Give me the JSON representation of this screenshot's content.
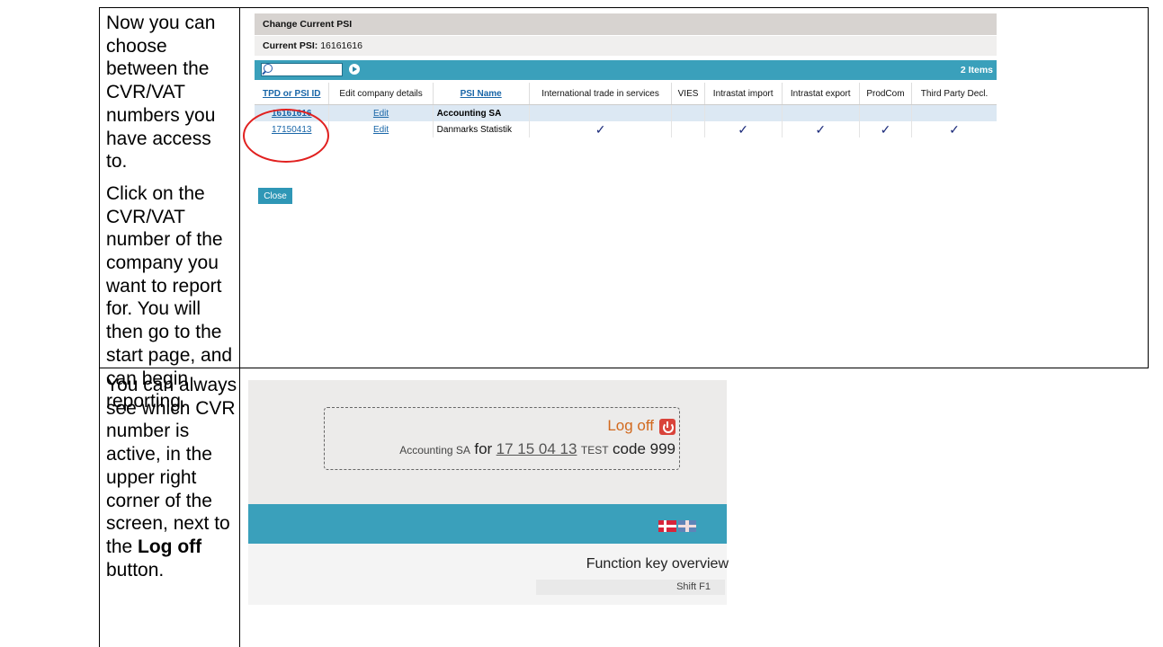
{
  "instructions": {
    "step1_text": "Now you can choose between the CVR/VAT numbers you have access to.",
    "step2_text": "Click on the CVR/VAT number of the company you want to report for. You will then go to the start page, and can begin reporting.",
    "step3_text_before": "You can always see which CVR number is active, in the upper right corner of the screen, next to the ",
    "step3_bold": "Log off",
    "step3_text_after": " button."
  },
  "psi_dialog": {
    "title": "Change Current PSI",
    "current_label": "Current PSI:",
    "current_value": "16161616",
    "search_placeholder": "",
    "items_count": "2 Items",
    "columns": [
      "TPD or PSI ID",
      "Edit company details",
      "PSI Name",
      "International trade in services",
      "VIES",
      "Intrastat import",
      "Intrastat export",
      "ProdCom",
      "Third Party Decl."
    ],
    "rows": [
      {
        "id": "16161616",
        "edit": "Edit",
        "name": "Accounting SA",
        "checks": [
          "",
          "",
          "",
          "",
          "",
          ""
        ]
      },
      {
        "id": "17150413",
        "edit": "Edit",
        "name": "Danmarks Statistik",
        "checks": [
          "✓",
          "",
          "✓",
          "✓",
          "✓",
          "✓"
        ]
      }
    ],
    "close_label": "Close"
  },
  "header_panel": {
    "logoff_label": "Log off",
    "company": "Accounting SA",
    "for": "for",
    "cvr": "17 15 04 13",
    "test": "TEST",
    "code": "code 999",
    "function_key_title": "Function key overview",
    "function_key": "Shift F1"
  },
  "colors": {
    "teal_bar": "#3aa0bb",
    "link_blue": "#1966a8",
    "highlight_circle": "#e1201f",
    "logoff_orange": "#d2691e"
  }
}
